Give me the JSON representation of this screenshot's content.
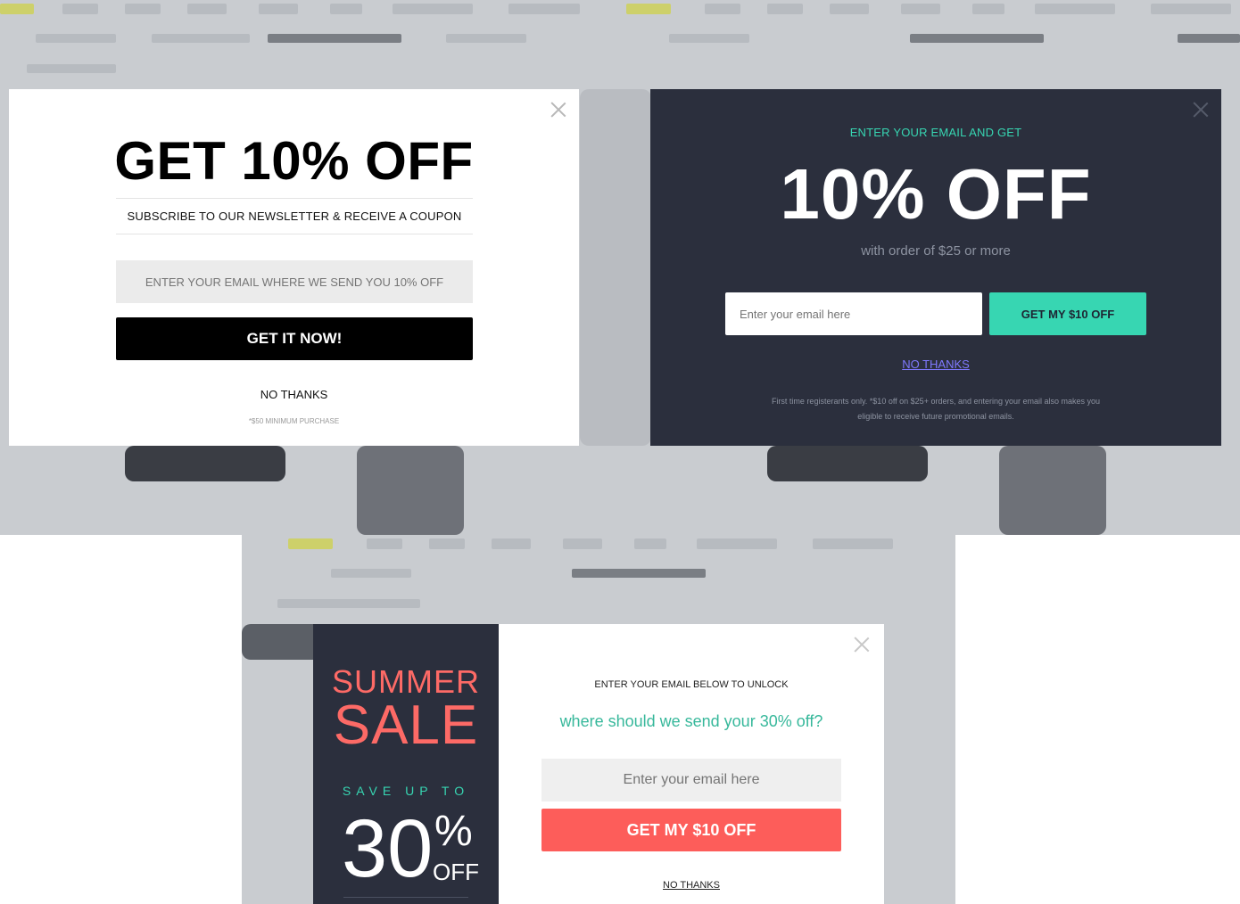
{
  "popup_white": {
    "headline": "GET 10% OFF",
    "subline": "SUBSCRIBE TO OUR NEWSLETTER & RECEIVE A COUPON",
    "email_placeholder": "ENTER YOUR EMAIL WHERE WE SEND YOU 10% OFF",
    "cta_label": "GET IT NOW!",
    "no_thanks": "NO THANKS",
    "fine_print": "*$50 MINIMUM PURCHASE",
    "close_icon": "close-icon"
  },
  "popup_dark": {
    "kicker": "ENTER YOUR EMAIL AND GET",
    "headline": "10% OFF",
    "subline": "with order of $25 or more",
    "email_placeholder": "Enter your email here",
    "cta_label": "GET MY $10 OFF",
    "no_thanks": "NO THANKS",
    "fine_print": "First time registerants only. *$10 off on $25+ orders, and entering your email also makes you eligible to receive future promotional emails.",
    "close_icon": "close-icon",
    "colors": {
      "background": "#2b2f3d",
      "accent": "#37d6b2",
      "link": "#7f79ff"
    }
  },
  "popup_split": {
    "side": {
      "summer": "SUMMER",
      "sale": "SALE",
      "save_up_to": "SAVE UP TO",
      "amount": "30",
      "percent": "%",
      "off": "OFF"
    },
    "kicker": "ENTER YOUR EMAIL BELOW TO UNLOCK",
    "subline": "where should we send your 30% off?",
    "email_placeholder": "Enter your email here",
    "cta_label": "GET MY $10 OFF",
    "no_thanks": "NO THANKS",
    "close_icon": "close-icon",
    "colors": {
      "sale": "#fd6a66",
      "accent": "#37d6b2",
      "cta": "#fd5d5a"
    }
  }
}
